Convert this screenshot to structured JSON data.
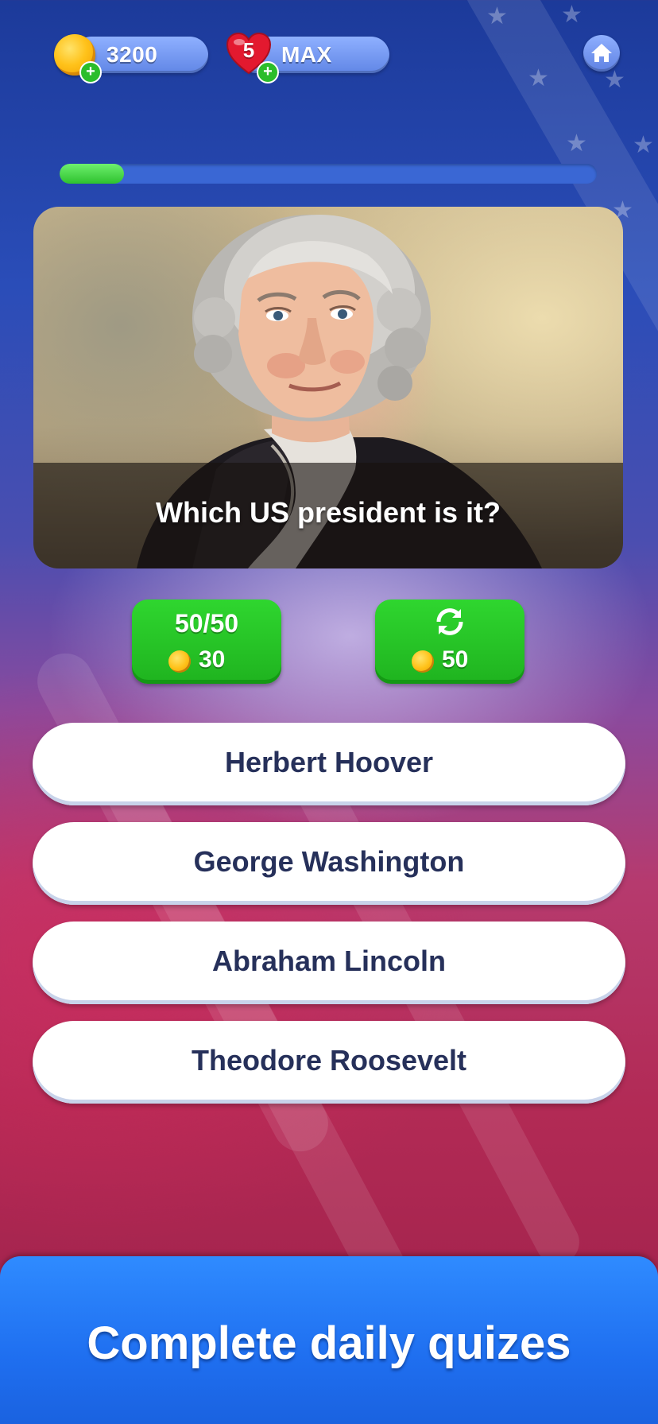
{
  "resources": {
    "coins": "3200",
    "lives_count": "5",
    "lives_status": "MAX"
  },
  "progress": {
    "value": 0.12
  },
  "question": {
    "text": "Which US president is it?",
    "image": "george-washington-portrait"
  },
  "helpers": {
    "fifty_fifty": {
      "label": "50/50",
      "cost": "30"
    },
    "swap": {
      "icon": "refresh-icon",
      "cost": "50"
    }
  },
  "answers": [
    {
      "label": "Herbert Hoover"
    },
    {
      "label": "George Washington"
    },
    {
      "label": "Abraham Lincoln"
    },
    {
      "label": "Theodore Roosevelt"
    }
  ],
  "banner": {
    "text": "Complete daily quizes"
  },
  "colors": {
    "answer_text": "#26305a",
    "helper_green": "#1fb31f",
    "progress_fill": "#2ec12e",
    "banner_blue": "#1f6ff0"
  }
}
